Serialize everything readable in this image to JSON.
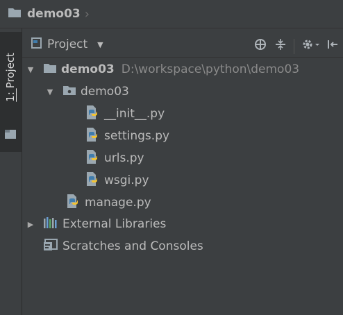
{
  "breadcrumb": {
    "title": "demo03"
  },
  "tool_window": {
    "tab_label_prefix": "1: ",
    "tab_label_name": "Project"
  },
  "panel": {
    "title": "Project"
  },
  "tree": {
    "root": {
      "name": "demo03",
      "path": "D:\\workspace\\python\\demo03"
    },
    "package": {
      "name": "demo03"
    },
    "files": [
      "__init__.py",
      "settings.py",
      "urls.py",
      "wsgi.py"
    ],
    "manage": "manage.py",
    "external": "External Libraries",
    "scratches": "Scratches and Consoles"
  },
  "icons": {
    "folder": "folder-icon",
    "python_file": "python-file-icon",
    "libraries": "libraries-icon",
    "scratches": "scratches-icon"
  },
  "colors": {
    "background": "#3c3f41",
    "text": "#bbbbbb",
    "path": "#8a8a8a",
    "python_blue": "#3f7cac",
    "python_yellow": "#f4c430"
  }
}
